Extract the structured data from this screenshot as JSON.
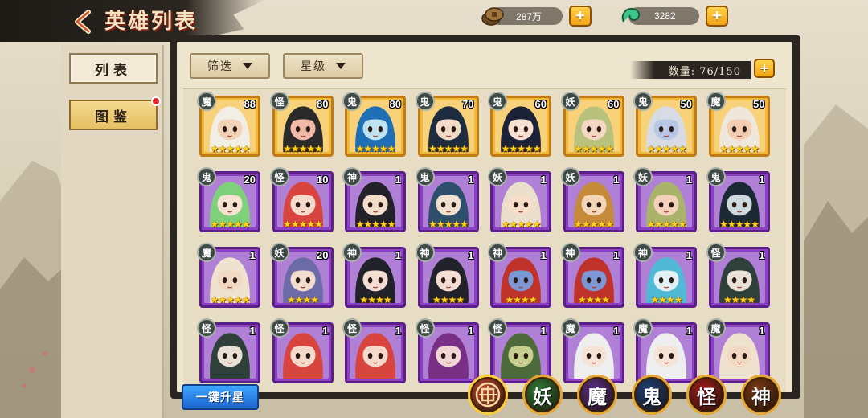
{
  "header": {
    "title": "英雄列表",
    "coins": "287万",
    "jade": "3282"
  },
  "sidebar": {
    "items": [
      {
        "label": "列表"
      },
      {
        "label": "图鉴"
      }
    ]
  },
  "toolbar": {
    "filter_label": "筛选",
    "star_label": "星级",
    "count_text": "数量: 76/150"
  },
  "heroes": [
    {
      "faction": "魔",
      "level": "88",
      "stars": 5,
      "frame": "gold",
      "hair": "#f1eee6",
      "skin": "#f3d3b8"
    },
    {
      "faction": "怪",
      "level": "80",
      "stars": 5,
      "frame": "gold",
      "hair": "#2a2a2a",
      "skin": "#f3b9a8"
    },
    {
      "faction": "鬼",
      "level": "80",
      "stars": 5,
      "frame": "gold",
      "hair": "#1f6fb7",
      "skin": "#bfe3f1"
    },
    {
      "faction": "鬼",
      "level": "70",
      "stars": 5,
      "frame": "gold",
      "hair": "#1e2c3f",
      "skin": "#f4dbc8"
    },
    {
      "faction": "鬼",
      "level": "60",
      "stars": 5,
      "frame": "gold",
      "hair": "#1c2238",
      "skin": "#f6e0d2"
    },
    {
      "faction": "妖",
      "level": "60",
      "stars": 5,
      "frame": "gold",
      "hair": "#b9c27c",
      "skin": "#f4d8c4"
    },
    {
      "faction": "鬼",
      "level": "50",
      "stars": 5,
      "frame": "gold",
      "hair": "#d6dbe6",
      "skin": "#b9c6e6"
    },
    {
      "faction": "魔",
      "level": "50",
      "stars": 5,
      "frame": "gold",
      "hair": "#efe6dc",
      "skin": "#f3cdb3"
    },
    {
      "faction": "鬼",
      "level": "20",
      "stars": 5,
      "frame": "purple",
      "hair": "#7fd07a",
      "skin": "#f6e2d0"
    },
    {
      "faction": "怪",
      "level": "10",
      "stars": 5,
      "frame": "purple",
      "hair": "#d8453f",
      "skin": "#f5dacc"
    },
    {
      "faction": "神",
      "level": "1",
      "stars": 5,
      "frame": "purple",
      "hair": "#23212a",
      "skin": "#f4dccb"
    },
    {
      "faction": "鬼",
      "level": "1",
      "stars": 5,
      "frame": "purple",
      "hair": "#2d4f6b",
      "skin": "#efe0cf"
    },
    {
      "faction": "妖",
      "level": "1",
      "stars": 5,
      "frame": "purple",
      "hair": "#e9dfcb",
      "skin": "#f6ddca"
    },
    {
      "faction": "妖",
      "level": "1",
      "stars": 5,
      "frame": "purple",
      "hair": "#c58a3a",
      "skin": "#f3d5b8"
    },
    {
      "faction": "妖",
      "level": "1",
      "stars": 5,
      "frame": "purple",
      "hair": "#a9b46a",
      "skin": "#f3d1bb"
    },
    {
      "faction": "鬼",
      "level": "1",
      "stars": 5,
      "frame": "purple",
      "hair": "#1b2a32",
      "skin": "#cdd9dd"
    },
    {
      "faction": "魔",
      "level": "1",
      "stars": 5,
      "frame": "purple",
      "hair": "#efe3cf",
      "skin": "#f2d9c3"
    },
    {
      "faction": "妖",
      "level": "20",
      "stars": 4,
      "frame": "purple",
      "hair": "#6d6aa8",
      "skin": "#f1dccd"
    },
    {
      "faction": "神",
      "level": "1",
      "stars": 4,
      "frame": "purple",
      "hair": "#22222a",
      "skin": "#f3dcd1"
    },
    {
      "faction": "神",
      "level": "1",
      "stars": 4,
      "frame": "purple",
      "hair": "#22222a",
      "skin": "#f3dcd1"
    },
    {
      "faction": "神",
      "level": "1",
      "stars": 4,
      "frame": "purple",
      "hair": "#c0332b",
      "skin": "#7c97d6"
    },
    {
      "faction": "神",
      "level": "1",
      "stars": 4,
      "frame": "purple",
      "hair": "#c0332b",
      "skin": "#7c97d6"
    },
    {
      "faction": "神",
      "level": "1",
      "stars": 4,
      "frame": "purple",
      "hair": "#4fb9d6",
      "skin": "#e3f0f3"
    },
    {
      "faction": "怪",
      "level": "1",
      "stars": 4,
      "frame": "purple",
      "hair": "#2f3f3a",
      "skin": "#e8e2d6"
    },
    {
      "faction": "怪",
      "level": "1",
      "stars": 0,
      "frame": "purple",
      "hair": "#2f3f3a",
      "skin": "#e8e2d6"
    },
    {
      "faction": "怪",
      "level": "1",
      "stars": 0,
      "frame": "purple",
      "hair": "#d8453f",
      "skin": "#f5dacc"
    },
    {
      "faction": "怪",
      "level": "1",
      "stars": 0,
      "frame": "purple",
      "hair": "#d8453f",
      "skin": "#f5dacc"
    },
    {
      "faction": "怪",
      "level": "1",
      "stars": 0,
      "frame": "purple",
      "hair": "#7a2f86",
      "skin": "#f1d6d6"
    },
    {
      "faction": "怪",
      "level": "1",
      "stars": 0,
      "frame": "purple",
      "hair": "#4d6b3a",
      "skin": "#c6cf8f"
    },
    {
      "faction": "魔",
      "level": "1",
      "stars": 0,
      "frame": "purple",
      "hair": "#eeeeee",
      "skin": "#f5e3d6"
    },
    {
      "faction": "魔",
      "level": "1",
      "stars": 0,
      "frame": "purple",
      "hair": "#eeeeee",
      "skin": "#f5e3d6"
    },
    {
      "faction": "魔",
      "level": "1",
      "stars": 0,
      "frame": "purple",
      "hair": "#efe3cf",
      "skin": "#f2d9c3"
    }
  ],
  "bottom": {
    "upgrade_label": "一键升星",
    "faction_filters": [
      {
        "label": "",
        "icon": "all-factions-icon",
        "color": "#b9472b"
      },
      {
        "label": "妖",
        "color": "#2f7a35"
      },
      {
        "label": "魔",
        "color": "#5a2f84"
      },
      {
        "label": "鬼",
        "color": "#1d3f76"
      },
      {
        "label": "怪",
        "color": "#9e1c1a"
      },
      {
        "label": "神",
        "color": "#7a3a12"
      }
    ]
  },
  "colors": {
    "gold_frame": "#f0b93a",
    "purple_frame": "#8b3fc3",
    "plus_button": "#f1a213",
    "upgrade_button": "#1b64d0"
  }
}
